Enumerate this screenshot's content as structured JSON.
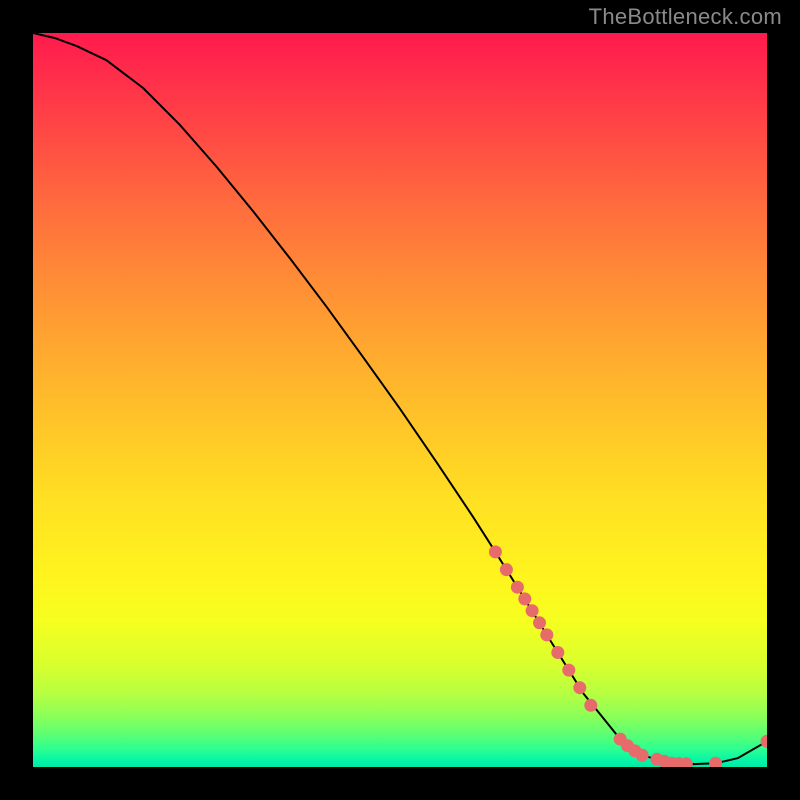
{
  "attribution": "TheBottleneck.com",
  "chart_data": {
    "type": "line",
    "title": "",
    "xlabel": "",
    "ylabel": "",
    "xlim": [
      0,
      100
    ],
    "ylim": [
      0,
      100
    ],
    "series": [
      {
        "name": "main-curve",
        "x": [
          0,
          3,
          6,
          10,
          15,
          20,
          25,
          30,
          35,
          40,
          45,
          50,
          55,
          60,
          63,
          66,
          70,
          75,
          80,
          83,
          87,
          90,
          93,
          96,
          100
        ],
        "y": [
          100,
          99.3,
          98.2,
          96.3,
          92.5,
          87.5,
          81.8,
          75.7,
          69.3,
          62.7,
          55.8,
          48.8,
          41.5,
          34.0,
          29.3,
          24.5,
          18.0,
          10.0,
          3.8,
          1.6,
          0.5,
          0.4,
          0.5,
          1.2,
          3.5
        ]
      }
    ],
    "markers": [
      {
        "x": 63,
        "y": 29.3
      },
      {
        "x": 64.5,
        "y": 26.9
      },
      {
        "x": 66,
        "y": 24.5
      },
      {
        "x": 67,
        "y": 22.9
      },
      {
        "x": 68,
        "y": 21.3
      },
      {
        "x": 69,
        "y": 19.65
      },
      {
        "x": 70,
        "y": 18.0
      },
      {
        "x": 71.5,
        "y": 15.6
      },
      {
        "x": 73,
        "y": 13.2
      },
      {
        "x": 74.5,
        "y": 10.8
      },
      {
        "x": 76,
        "y": 8.4
      },
      {
        "x": 80,
        "y": 3.8
      },
      {
        "x": 81,
        "y": 2.9
      },
      {
        "x": 82,
        "y": 2.2
      },
      {
        "x": 83,
        "y": 1.6
      },
      {
        "x": 85,
        "y": 1.05
      },
      {
        "x": 86,
        "y": 0.78
      },
      {
        "x": 87,
        "y": 0.5
      },
      {
        "x": 88,
        "y": 0.47
      },
      {
        "x": 89,
        "y": 0.43
      },
      {
        "x": 93,
        "y": 0.5
      },
      {
        "x": 100,
        "y": 3.5
      }
    ],
    "marker_color": "#e86b6b",
    "line_color": "#000000"
  }
}
